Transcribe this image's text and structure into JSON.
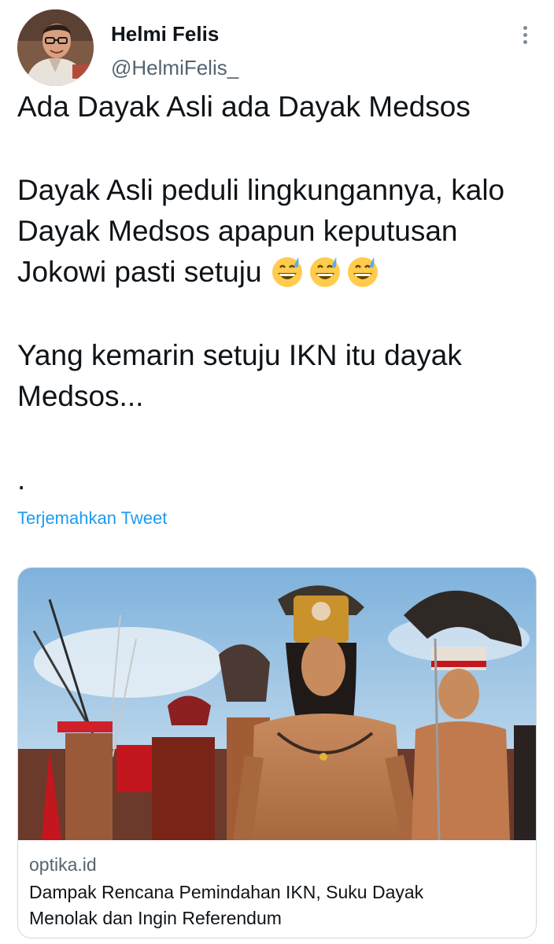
{
  "author": {
    "display_name": "Helmi Felis",
    "handle": "@HelmiFelis_"
  },
  "tweet": {
    "line1": "Ada Dayak Asli ada Dayak Medsos",
    "para2": "Dayak Asli peduli lingkungannya, kalo\nDayak Medsos apapun keputusan\nJokowi pasti setuju",
    "emojis": [
      "grinning-face-with-sweat-icon",
      "grinning-face-with-sweat-icon",
      "grinning-face-with-sweat-icon"
    ],
    "para3": "Yang kemarin setuju IKN itu dayak\nMedsos...",
    "dot": "."
  },
  "translate_label": "Terjemahkan Tweet",
  "link_card": {
    "domain": "optika.id",
    "title": "Dampak Rencana Pemindahan IKN, Suku Dayak\nMenolak dan Ingin Referendum"
  },
  "colors": {
    "link_blue": "#1d9bf0",
    "secondary_text": "#536471",
    "border": "#cfd9de"
  }
}
